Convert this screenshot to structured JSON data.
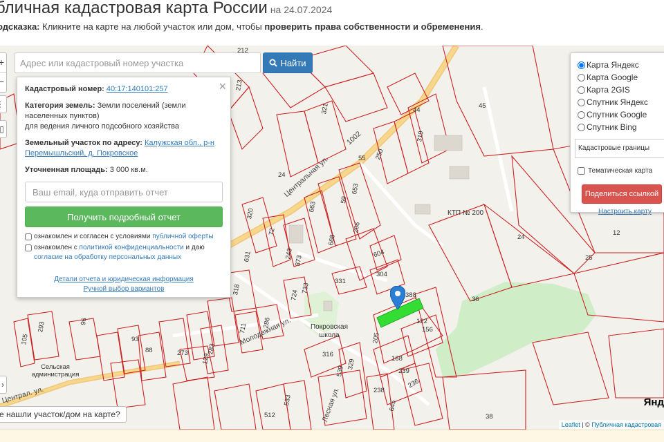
{
  "header": {
    "title": "бличная кадастровая карта России",
    "date": "на 24.07.2024",
    "hint_label": "одсказка:",
    "hint_text": " Кликните на карте на любой участок или дом, чтобы ",
    "hint_bold": "проверить права собственности и обременения",
    "hint_end": "."
  },
  "search": {
    "placeholder": "Адрес или кадастровый номер участка",
    "button_label": "Найти"
  },
  "popup": {
    "cadastral_label": "Кадастровый номер:",
    "cadastral_value": "40:17:140101:257",
    "category_label": "Категория земель:",
    "category_value": "Земли поселений (земли населенных пунктов)",
    "category_usage": "для ведения личного подсобного хозяйства",
    "address_label": "Земельный участок по адресу:",
    "address_value": "Калужская обл., р-н Перемышльский, д. Покровское",
    "area_label": "Уточненная площадь:",
    "area_value": "3 000 кв.м.",
    "email_placeholder": "Ваш email, куда отправить отчет",
    "report_button": "Получить подробный отчет",
    "consent1_text": "ознакомлен и согласен с условиями ",
    "consent1_link": "публичной оферты",
    "consent2_text": "ознакомлен с ",
    "consent2_link": "политикой конфиденциальности",
    "consent2_mid": " и даю ",
    "consent2_link2": "согласие на обработку персональных данных",
    "details_link": "Детали отчета и юридическая информация",
    "manual_link": "Ручной выбор вариантов"
  },
  "layers": {
    "options": [
      "Карта Яндекс",
      "Карта Google",
      "Карта 2GIS",
      "Спутник Яндекс",
      "Спутник Google",
      "Спутник Bing"
    ],
    "selected": "Карта Яндекс",
    "boundary_select": "Кадастровые границы",
    "thematic_label": "Тематическая карта",
    "share_button": "Поделиться ссылкой",
    "setup_link": "Настроить карту"
  },
  "map": {
    "not_found": "е нашли участок/дом на карте?",
    "attribution_leaflet": "Leaflet",
    "attribution_sep": " | © ",
    "attribution_pkk": "Публичная кадастровая",
    "yandex_logo": "Янд",
    "ktp_label": "КТП № 200",
    "school_label": "Покровская школа",
    "admin_label": "Сельская администрация",
    "streets": {
      "central": "Центральная ул.",
      "molodezhnaya": "Молодежная ул.",
      "central_sw": "Централ. ул.",
      "lesnaya": "Лесная ул.",
      "road_num": "1002"
    },
    "parcel_numbers": [
      "212",
      "213",
      "321",
      "44",
      "319",
      "45",
      "55",
      "250",
      "653",
      "59",
      "206",
      "663",
      "668",
      "320",
      "72",
      "243",
      "373",
      "631",
      "604",
      "304",
      "331",
      "733",
      "724",
      "318",
      "388",
      "122",
      "156",
      "205",
      "36",
      "24",
      "12",
      "25",
      "316",
      "329",
      "539",
      "168",
      "239",
      "236",
      "238",
      "512",
      "533",
      "645",
      "105",
      "293",
      "96",
      "93",
      "88",
      "273",
      "129",
      "283",
      "711",
      "286",
      "38",
      "24"
    ]
  },
  "colors": {
    "accent_blue": "#337ab7",
    "report_green": "#5cb85c",
    "share_red": "#d9534f",
    "parcel_red": "#cc2222",
    "selected_parcel": "#33dd33",
    "road_yellow": "#f7d78c",
    "forest_green": "#cfeec7"
  }
}
